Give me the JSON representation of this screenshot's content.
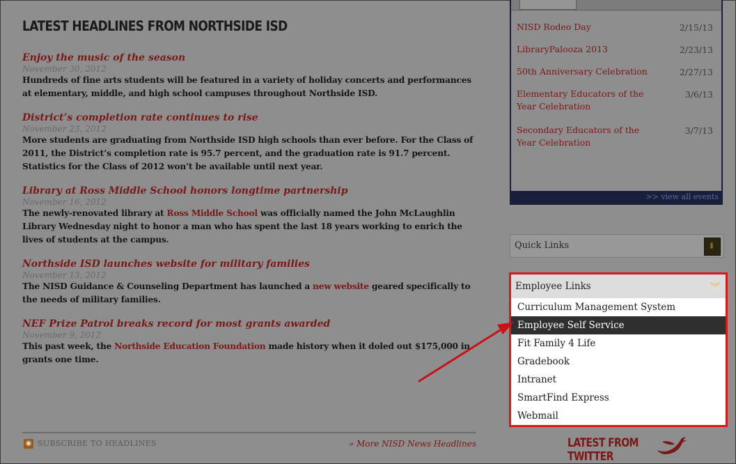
{
  "news": {
    "heading": "LATEST HEADLINES FROM NORTHSIDE ISD",
    "items": [
      {
        "title": "Enjoy the music of the season",
        "date": "November 30, 2012",
        "body": "Hundreds of fine arts students will be featured in a variety of holiday concerts and performances at elementary, middle, and high school campuses throughout Northside ISD."
      },
      {
        "title": "District’s completion rate continues to rise",
        "date": "November 23, 2012",
        "body": "More students are graduating from Northside ISD high schools than ever before. For the Class of 2011, the District’s completion rate is 95.7 percent, and the graduation rate is 91.7 percent. Statistics for the Class of 2012 won’t be available until next year."
      },
      {
        "title": "Library at Ross Middle School honors longtime partnership",
        "date": "November 16, 2012",
        "body_pre": "The newly-renovated library at ",
        "body_link": "Ross Middle School",
        "body_post": " was officially named the John McLaughlin Library Wednesday night to honor a man who has spent the last 18 years working to enrich the lives of students at the campus."
      },
      {
        "title": "Northside ISD launches website for military families",
        "date": "November 13, 2012",
        "body_pre": "The NISD Guidance & Counseling Department has launched a ",
        "body_link": "new website",
        "body_post": " geared specifically to the needs of military families."
      },
      {
        "title": "NEF Prize Patrol breaks record for most grants awarded",
        "date": "November 9, 2012",
        "body_pre": "This past week, the ",
        "body_link": "Northside Education Foundation",
        "body_post": " made history when it doled out $175,000 in grants one time."
      }
    ],
    "subscribe_label": "SUBSCRIBE TO HEADLINES",
    "more_label": "» More NISD News Headlines"
  },
  "events": {
    "items": [
      {
        "name": "NISD Rodeo Day",
        "date": "2/15/13"
      },
      {
        "name": "LibraryPalooza 2013",
        "date": "2/23/13"
      },
      {
        "name": "50th Anniversary Celebration",
        "date": "2/27/13"
      },
      {
        "name": "Elementary Educators of the Year Celebration",
        "date": "3/6/13"
      },
      {
        "name": "Secondary Educators of the Year Celebration",
        "date": "3/7/13"
      }
    ],
    "view_all": ">> view all events"
  },
  "quick_links": {
    "label": "Quick Links"
  },
  "employee_links": {
    "label": "Employee Links",
    "items": [
      "Curriculum Management System",
      "Employee Self Service",
      "Fit Family 4 Life",
      "Gradebook",
      "Intranet",
      "SmartFind Express",
      "Webmail"
    ],
    "selected": "Employee Self Service"
  },
  "twitter": {
    "label": "LATEST FROM TWITTER"
  },
  "colors": {
    "highlight_border": "#d21a1f",
    "selected_row": "#2f2f2f",
    "headline_red": "#7a1818",
    "overlay_gray": "#8e8e8e"
  }
}
